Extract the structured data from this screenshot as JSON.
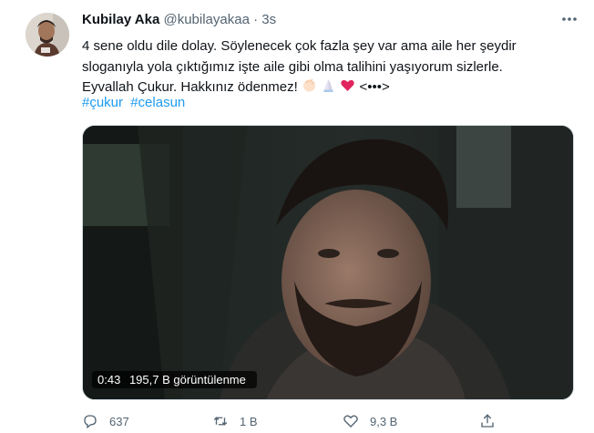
{
  "author": {
    "name": "Kubilay Aka",
    "handle": "@kubilayakaa",
    "separator": "·",
    "time": "3s"
  },
  "tweet": {
    "lines": [
      "4 sene oldu dile dolay. Söylenecek çok fazla şey var ama aile her şeydir",
      "sloganıyla yola çıktığımız işte aile gibi olma talihini yaşıyorum sizlerle.",
      "Eyvallah Çukur. Hakkınız ödenmez!"
    ],
    "emojis": [
      "clapping-hands-emoji",
      "praying-hands-emoji",
      "red-heart-emoji"
    ],
    "trailing_symbol": "<•••>",
    "hashtags": [
      "#çukur",
      "#celasun"
    ]
  },
  "media": {
    "duration": "0:43",
    "views": "195,7 B görüntülenme"
  },
  "actions": {
    "reply_count": "637",
    "retweet_count": "1 B",
    "like_count": "9,3 B"
  },
  "icons": {
    "more": "more-horizontal-icon",
    "reply": "reply-icon",
    "retweet": "retweet-icon",
    "like": "heart-icon",
    "share": "share-icon"
  },
  "colors": {
    "link": "#1d9bf0",
    "secondary_text": "#536471",
    "heart": "#e0245e"
  }
}
